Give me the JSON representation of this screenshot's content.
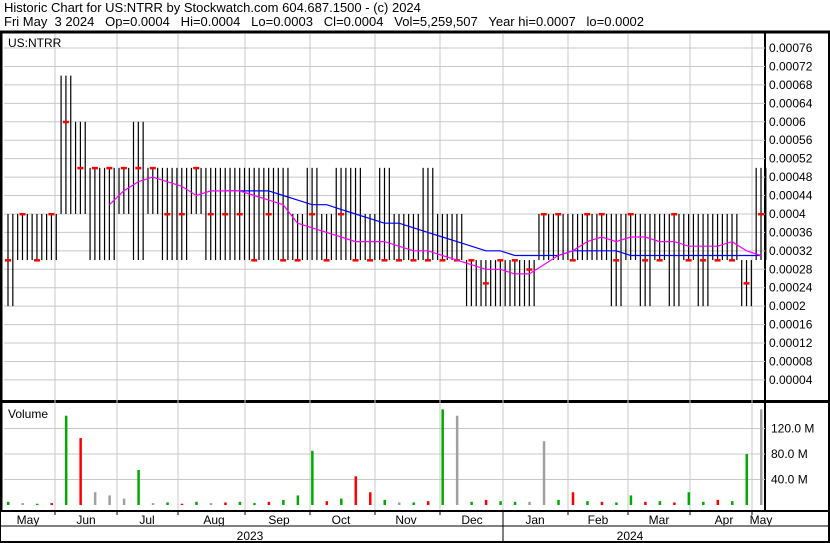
{
  "header": {
    "title": "Historic Chart for US:NTRR by Stockwatch.com 604.687.1500 - (c) 2024",
    "quote": "Fri May  3 2024   Op=0.0004   Hi=0.0004   Lo=0.0003   Cl=0.0004   Vol=5,259,507   Year hi=0.0007   lo=0.0002"
  },
  "chart_data": {
    "type": "ohlc",
    "symbol": "US:NTRR",
    "volume_label": "Volume",
    "price_ticks": [
      "0.00076",
      "0.00072",
      "0.00068",
      "0.00064",
      "0.0006",
      "0.00056",
      "0.00052",
      "0.00048",
      "0.00044",
      "0.0004",
      "0.00036",
      "0.00032",
      "0.00028",
      "0.00024",
      "0.0002",
      "0.00016",
      "0.00012",
      "0.00008",
      "0.00004"
    ],
    "price_tick_values": [
      0.00076,
      0.00072,
      0.00068,
      0.00064,
      0.0006,
      0.00056,
      0.00052,
      0.00048,
      0.00044,
      0.0004,
      0.00036,
      0.00032,
      0.00028,
      0.00024,
      0.0002,
      0.00016,
      0.00012,
      8e-05,
      4e-05
    ],
    "ylim": [
      0,
      0.00078
    ],
    "volume_ticks": [
      "120.0 M",
      "80.0 M",
      "40.0 M"
    ],
    "volume_tick_values": [
      120,
      80,
      40
    ],
    "months": [
      "May",
      "Jun",
      "Jul",
      "Aug",
      "Sep",
      "Oct",
      "Nov",
      "Dec",
      "Jan",
      "Feb",
      "Mar",
      "Apr",
      "May"
    ],
    "years": [
      "2023",
      "2024"
    ],
    "colors": {
      "bar": "#000000",
      "close": "#ff0000",
      "ma_short": "#ff00ff",
      "ma_long": "#0000ff",
      "vol_up": "#00aa00",
      "vol_down": "#ff0000",
      "vol_flat": "#a0a0a0"
    },
    "bars": [
      [
        0.0004,
        0.0002,
        0.0003
      ],
      [
        0.0004,
        0.0003,
        0.0004
      ],
      [
        0.0004,
        0.0003,
        0.0003
      ],
      [
        0.0004,
        0.0003,
        0.0004
      ],
      [
        0.0007,
        0.0004,
        0.0006
      ],
      [
        0.0006,
        0.0004,
        0.0005
      ],
      [
        0.0005,
        0.0003,
        0.0005
      ],
      [
        0.0005,
        0.0003,
        0.0005
      ],
      [
        0.0005,
        0.0004,
        0.0005
      ],
      [
        0.0006,
        0.0003,
        0.0005
      ],
      [
        0.0005,
        0.0004,
        0.0005
      ],
      [
        0.0005,
        0.0003,
        0.0004
      ],
      [
        0.0005,
        0.0003,
        0.0004
      ],
      [
        0.0005,
        0.0004,
        0.0005
      ],
      [
        0.0005,
        0.0003,
        0.0004
      ],
      [
        0.0005,
        0.0003,
        0.0004
      ],
      [
        0.0005,
        0.0003,
        0.0004
      ],
      [
        0.0005,
        0.0003,
        0.0003
      ],
      [
        0.0005,
        0.0003,
        0.0004
      ],
      [
        0.0005,
        0.0003,
        0.0003
      ],
      [
        0.0004,
        0.0003,
        0.0003
      ],
      [
        0.0005,
        0.0003,
        0.0004
      ],
      [
        0.0004,
        0.0003,
        0.0003
      ],
      [
        0.0005,
        0.0003,
        0.0004
      ],
      [
        0.0005,
        0.0003,
        0.0003
      ],
      [
        0.0004,
        0.0003,
        0.0003
      ],
      [
        0.0005,
        0.0003,
        0.0003
      ],
      [
        0.0004,
        0.0003,
        0.0003
      ],
      [
        0.0004,
        0.0003,
        0.0003
      ],
      [
        0.0005,
        0.0003,
        0.0003
      ],
      [
        0.0004,
        0.0003,
        0.0003
      ],
      [
        0.0004,
        0.0003,
        0.0003
      ],
      [
        0.0003,
        0.0002,
        0.0003
      ],
      [
        0.0003,
        0.0002,
        0.00025
      ],
      [
        0.0003,
        0.0002,
        0.0003
      ],
      [
        0.0003,
        0.0002,
        0.0003
      ],
      [
        0.0003,
        0.0002,
        0.00028
      ],
      [
        0.0004,
        0.0003,
        0.0004
      ],
      [
        0.0004,
        0.0003,
        0.0004
      ],
      [
        0.0004,
        0.0003,
        0.0003
      ],
      [
        0.0004,
        0.0003,
        0.0004
      ],
      [
        0.0004,
        0.0003,
        0.0004
      ],
      [
        0.0004,
        0.0002,
        0.0003
      ],
      [
        0.0004,
        0.0003,
        0.0004
      ],
      [
        0.0004,
        0.0002,
        0.0003
      ],
      [
        0.0004,
        0.0003,
        0.0003
      ],
      [
        0.0004,
        0.0002,
        0.0004
      ],
      [
        0.0004,
        0.0003,
        0.0003
      ],
      [
        0.0004,
        0.0002,
        0.0003
      ],
      [
        0.0004,
        0.0003,
        0.0003
      ],
      [
        0.0004,
        0.0003,
        0.0003
      ],
      [
        0.0003,
        0.0002,
        0.00025
      ],
      [
        0.0005,
        0.0003,
        0.0004
      ]
    ],
    "ma_short": [
      null,
      null,
      null,
      null,
      null,
      null,
      null,
      0.00042,
      0.00045,
      0.00047,
      0.00048,
      0.00047,
      0.00046,
      0.00044,
      0.00045,
      0.00045,
      0.00045,
      0.00044,
      0.00043,
      0.00042,
      0.00038,
      0.00037,
      0.00036,
      0.00035,
      0.00034,
      0.00034,
      0.00034,
      0.00033,
      0.00032,
      0.00032,
      0.00031,
      0.0003,
      0.00029,
      0.00028,
      0.00028,
      0.00027,
      0.00027,
      0.00029,
      0.00031,
      0.00032,
      0.00034,
      0.00035,
      0.00034,
      0.00035,
      0.00035,
      0.00034,
      0.00034,
      0.00033,
      0.00033,
      0.00033,
      0.00034,
      0.00032,
      0.00031
    ],
    "ma_long": [
      null,
      null,
      null,
      null,
      null,
      null,
      null,
      null,
      null,
      null,
      null,
      null,
      null,
      null,
      null,
      0.00045,
      0.00045,
      0.00045,
      0.00045,
      0.00044,
      0.00043,
      0.00042,
      0.00042,
      0.00041,
      0.0004,
      0.00039,
      0.00038,
      0.00038,
      0.00037,
      0.00036,
      0.00035,
      0.00034,
      0.00033,
      0.00032,
      0.00032,
      0.00031,
      0.00031,
      0.00031,
      0.00031,
      0.00032,
      0.00032,
      0.00032,
      0.00032,
      0.00031,
      0.00031,
      0.00031,
      0.00031,
      0.00031,
      0.00031,
      0.00031,
      0.00031,
      0.00031,
      0.00031
    ],
    "volume": [
      [
        5,
        "u"
      ],
      [
        3,
        "f"
      ],
      [
        2,
        "u"
      ],
      [
        3,
        "d"
      ],
      [
        140,
        "u"
      ],
      [
        105,
        "d"
      ],
      [
        20,
        "f"
      ],
      [
        15,
        "f"
      ],
      [
        10,
        "f"
      ],
      [
        55,
        "u"
      ],
      [
        3,
        "f"
      ],
      [
        4,
        "u"
      ],
      [
        2,
        "d"
      ],
      [
        5,
        "u"
      ],
      [
        3,
        "f"
      ],
      [
        4,
        "d"
      ],
      [
        5,
        "u"
      ],
      [
        3,
        "u"
      ],
      [
        5,
        "d"
      ],
      [
        8,
        "u"
      ],
      [
        15,
        "u"
      ],
      [
        85,
        "u"
      ],
      [
        6,
        "d"
      ],
      [
        10,
        "u"
      ],
      [
        45,
        "d"
      ],
      [
        20,
        "d"
      ],
      [
        8,
        "u"
      ],
      [
        4,
        "f"
      ],
      [
        4,
        "u"
      ],
      [
        6,
        "d"
      ],
      [
        150,
        "u"
      ],
      [
        140,
        "f"
      ],
      [
        5,
        "u"
      ],
      [
        8,
        "d"
      ],
      [
        6,
        "u"
      ],
      [
        5,
        "u"
      ],
      [
        5,
        "f"
      ],
      [
        100,
        "f"
      ],
      [
        8,
        "u"
      ],
      [
        20,
        "d"
      ],
      [
        6,
        "u"
      ],
      [
        5,
        "d"
      ],
      [
        4,
        "u"
      ],
      [
        15,
        "u"
      ],
      [
        5,
        "d"
      ],
      [
        6,
        "u"
      ],
      [
        4,
        "d"
      ],
      [
        20,
        "u"
      ],
      [
        5,
        "u"
      ],
      [
        8,
        "d"
      ],
      [
        6,
        "u"
      ],
      [
        80,
        "u"
      ],
      [
        150,
        "f"
      ]
    ]
  }
}
